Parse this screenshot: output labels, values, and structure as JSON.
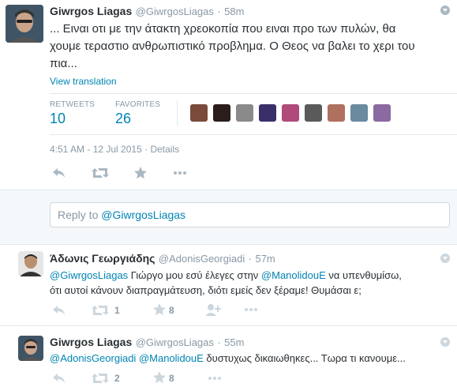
{
  "main_tweet": {
    "name": "Giwrgos Liagas",
    "handle": "@GiwrgosLiagas",
    "separator": "·",
    "time": "58m",
    "text_line1": "... Ειναι οτι με την άτακτη χρεοκοπία που ειναι προ των πυλών, θα",
    "text_line2": "χουμε τεραστιο ανθρωπιστικό προβλημα. Ο Θεος να βαλει το χερι του",
    "text_line3": "πια...",
    "view_translation": "View translation",
    "retweets_label": "RETWEETS",
    "retweets_count": "10",
    "favorites_label": "FAVORITES",
    "favorites_count": "26",
    "timestamp": "4:51 AM - 12 Jul 2015",
    "details": "Details",
    "avatars": [
      "#7a4a3a",
      "#2a1d1a",
      "#8a8a8a",
      "#3b2f6a",
      "#b04a7a",
      "#5a5a5a",
      "#b07060",
      "#6a8aa0",
      "#8a6aa0"
    ]
  },
  "reply_box": {
    "placeholder_prefix": "Reply to ",
    "placeholder_mention": "@GiwrgosLiagas"
  },
  "reply1": {
    "name": "Άδωνις Γεωργιάδης",
    "handle": "@AdonisGeorgiadi",
    "separator": "·",
    "time": "57m",
    "mention1": "@GiwrgosLiagas",
    "text_a": " Γιώργο μου εσύ έλεγες στην ",
    "mention2": "@ManolidouE",
    "text_b": " να υπενθυμίσω,",
    "line2": "ότι αυτοί κάνουν διαπραγμάτευση, διότι εμείς δεν ξέραμε! Θυμάσαι ε;",
    "retweets": "1",
    "favorites": "8"
  },
  "reply2": {
    "name": "Giwrgos Liagas",
    "handle": "@GiwrgosLiagas",
    "separator": "·",
    "time": "55m",
    "mention1": "@AdonisGeorgiadi",
    "mention2": "@ManolidouE",
    "text": " δυστυχως δικαιωθηκες... Τωρα τι κανουμε...",
    "retweets": "2",
    "favorites": "8"
  }
}
